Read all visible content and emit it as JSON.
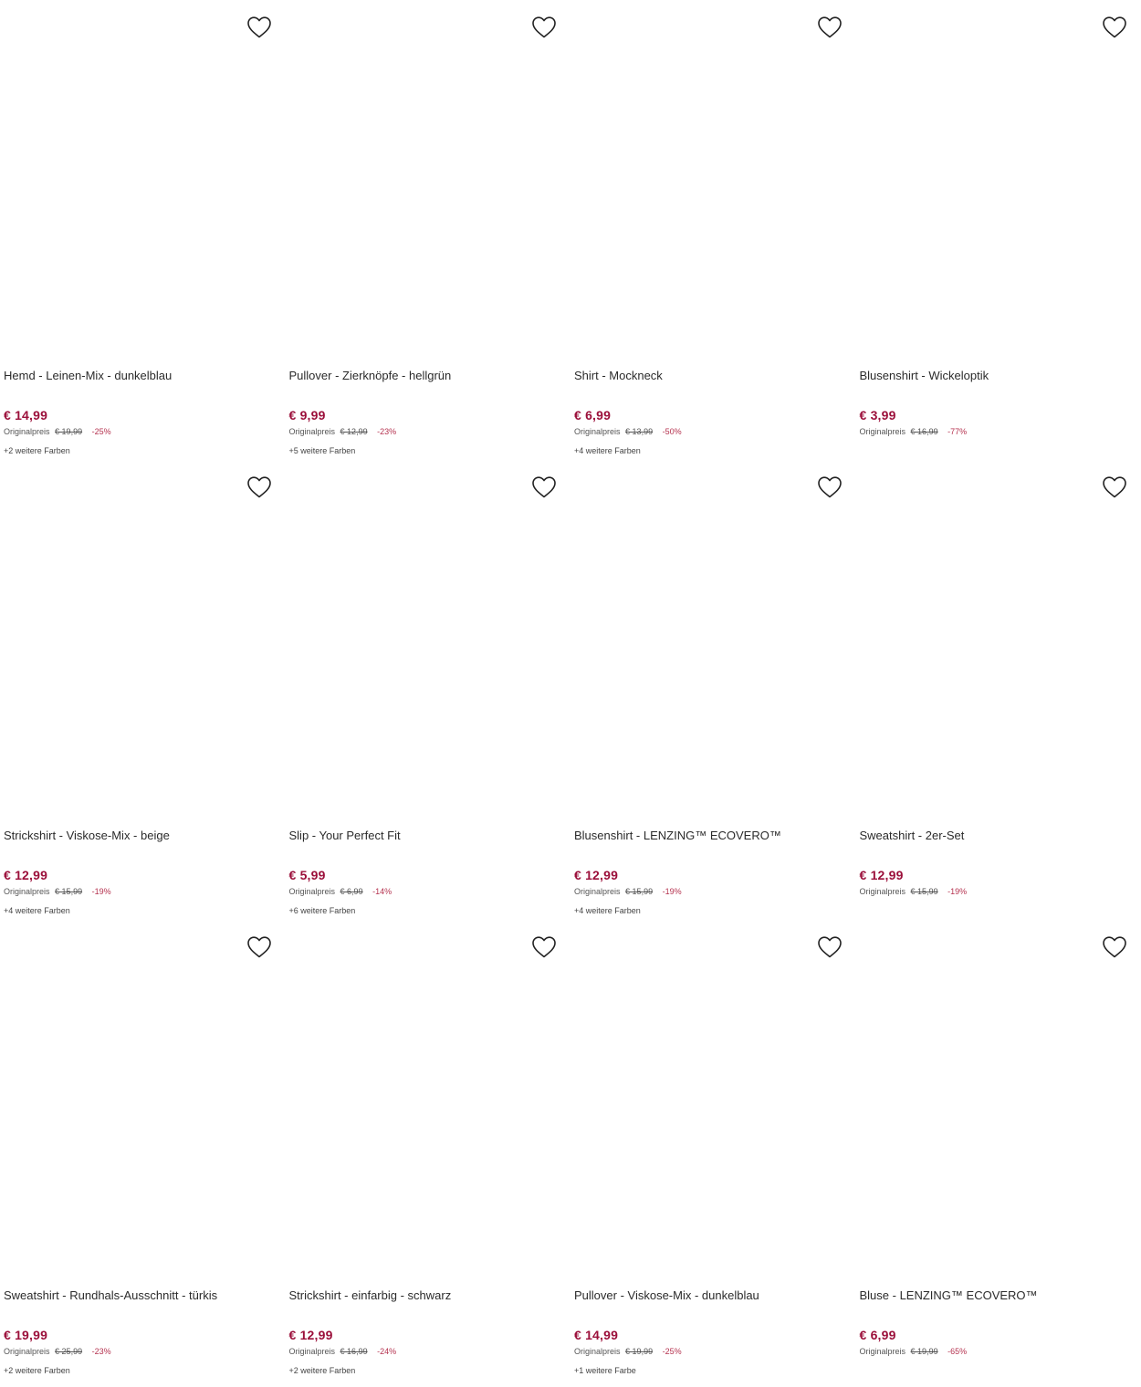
{
  "colors": {
    "price": "#9b0f3a",
    "discount": "#b5324f",
    "text": "#2b2b2b"
  },
  "icons": {
    "wishlist": "heart-outline-icon"
  },
  "products": [
    {
      "title": "Hemd - Leinen-Mix - dunkelblau",
      "price": "€ 14,99",
      "original_label": "Originalpreis",
      "original_price": "€ 19,99",
      "discount": "-25%",
      "colors_text": "+2 weitere Farben"
    },
    {
      "title": "Pullover - Zierknöpfe - hellgrün",
      "price": "€ 9,99",
      "original_label": "Originalpreis",
      "original_price": "€ 12,99",
      "discount": "-23%",
      "colors_text": "+5 weitere Farben"
    },
    {
      "title": "Shirt - Mockneck",
      "price": "€ 6,99",
      "original_label": "Originalpreis",
      "original_price": "€ 13,99",
      "discount": "-50%",
      "colors_text": "+4 weitere Farben"
    },
    {
      "title": "Blusenshirt - Wickeloptik",
      "price": "€ 3,99",
      "original_label": "Originalpreis",
      "original_price": "€ 16,99",
      "discount": "-77%",
      "colors_text": ""
    },
    {
      "title": "Strickshirt - Viskose-Mix - beige",
      "price": "€ 12,99",
      "original_label": "Originalpreis",
      "original_price": "€ 15,99",
      "discount": "-19%",
      "colors_text": "+4 weitere Farben"
    },
    {
      "title": "Slip - Your Perfect Fit",
      "price": "€ 5,99",
      "original_label": "Originalpreis",
      "original_price": "€ 6,99",
      "discount": "-14%",
      "colors_text": "+6 weitere Farben"
    },
    {
      "title": "Blusenshirt - LENZING™ ECOVERO™",
      "price": "€ 12,99",
      "original_label": "Originalpreis",
      "original_price": "€ 15,99",
      "discount": "-19%",
      "colors_text": "+4 weitere Farben"
    },
    {
      "title": "Sweatshirt - 2er-Set",
      "price": "€ 12,99",
      "original_label": "Originalpreis",
      "original_price": "€ 15,99",
      "discount": "-19%",
      "colors_text": ""
    },
    {
      "title": "Sweatshirt - Rundhals-Ausschnitt - türkis",
      "price": "€ 19,99",
      "original_label": "Originalpreis",
      "original_price": "€ 25,99",
      "discount": "-23%",
      "colors_text": "+2 weitere Farben"
    },
    {
      "title": "Strickshirt - einfarbig - schwarz",
      "price": "€ 12,99",
      "original_label": "Originalpreis",
      "original_price": "€ 16,99",
      "discount": "-24%",
      "colors_text": "+2 weitere Farben"
    },
    {
      "title": "Pullover - Viskose-Mix - dunkelblau",
      "price": "€ 14,99",
      "original_label": "Originalpreis",
      "original_price": "€ 19,99",
      "discount": "-25%",
      "colors_text": "+1 weitere Farbe"
    },
    {
      "title": "Bluse - LENZING™ ECOVERO™",
      "price": "€ 6,99",
      "original_label": "Originalpreis",
      "original_price": "€ 19,99",
      "discount": "-65%",
      "colors_text": ""
    }
  ]
}
